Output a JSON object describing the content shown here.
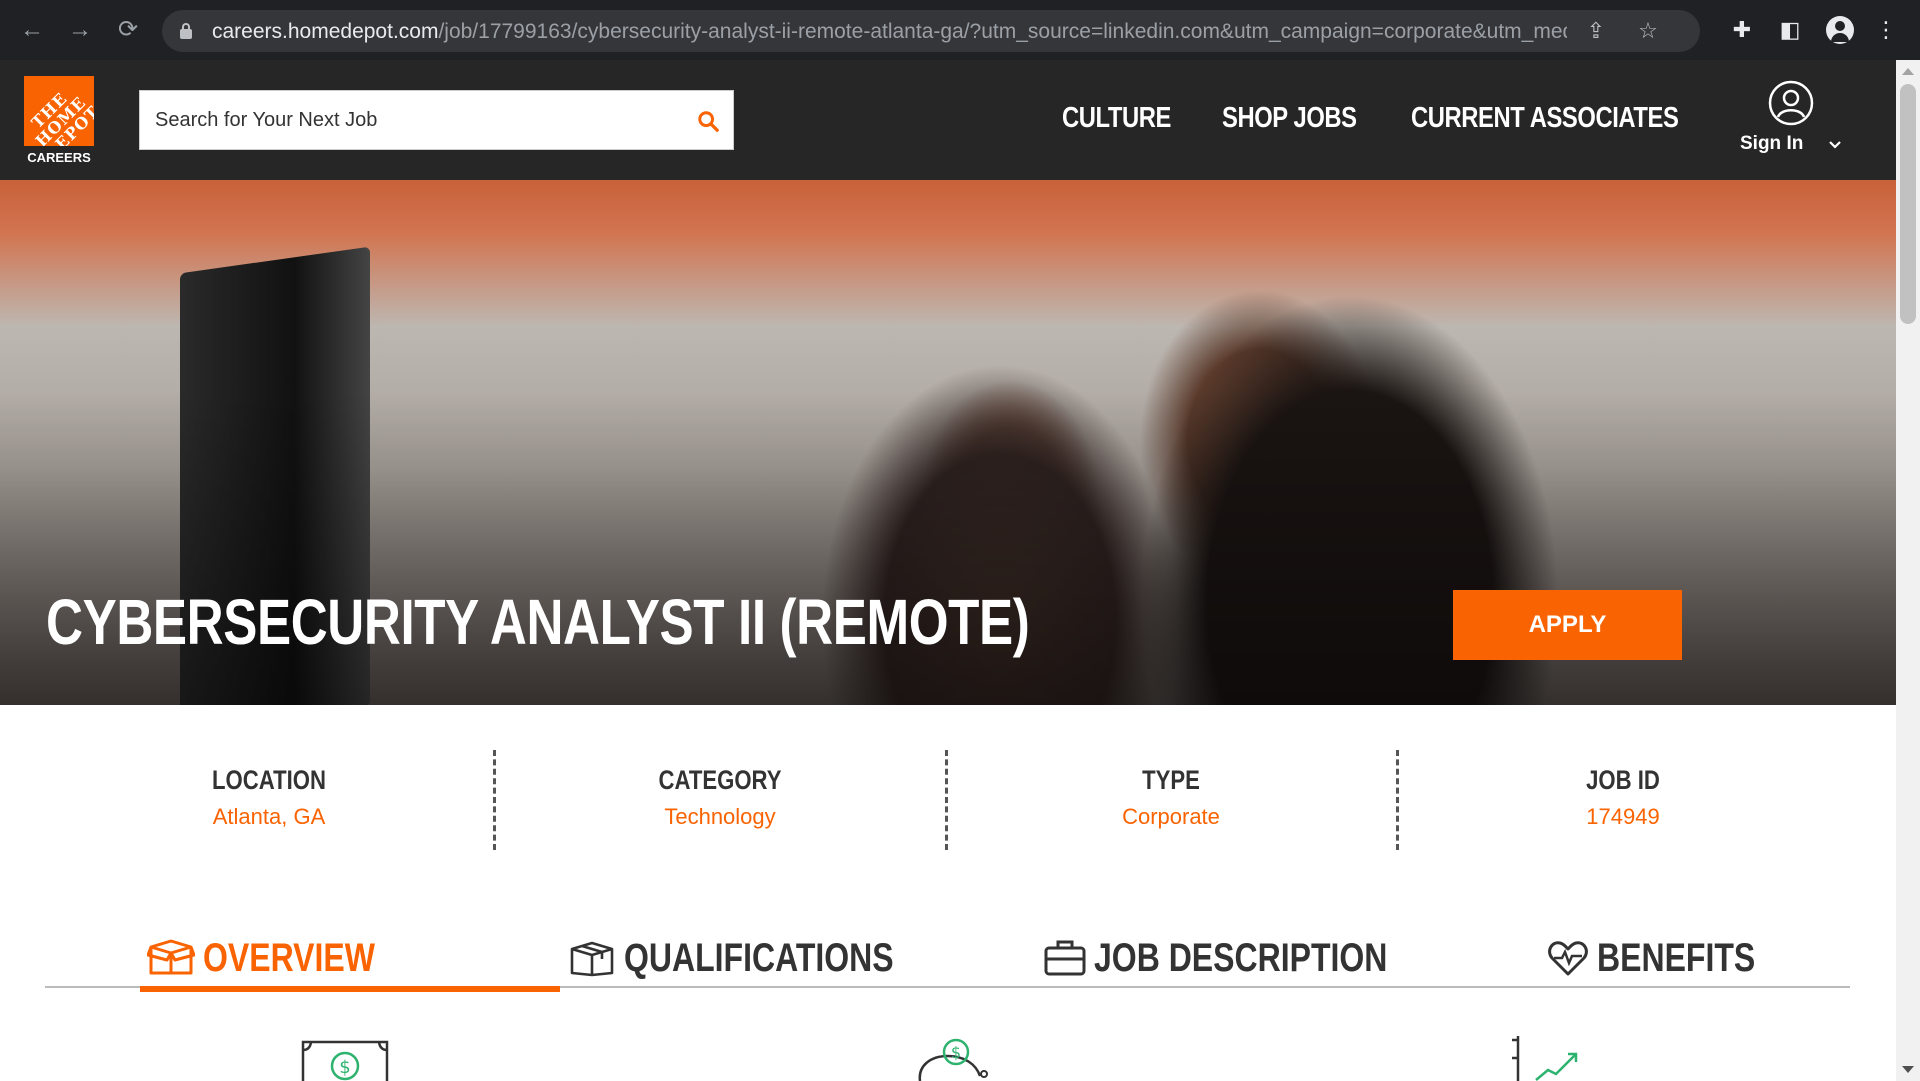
{
  "browser": {
    "url_host": "careers.homedepot.com",
    "url_path": "/job/17799163/cybersecurity-analyst-ii-remote-atlanta-ga/?utm_source=linkedin.com&utm_campaign=corporate&utm_med..."
  },
  "header": {
    "logo_text": "THE HOME DEPOT",
    "logo_caption": "CAREERS",
    "search_placeholder": "Search for Your Next Job",
    "nav": [
      "CULTURE",
      "SHOP JOBS",
      "CURRENT ASSOCIATES"
    ],
    "sign_in": "Sign In"
  },
  "hero": {
    "title": "CYBERSECURITY ANALYST II (REMOTE)",
    "apply_label": "APPLY"
  },
  "facts": [
    {
      "label": "LOCATION",
      "value": "Atlanta, GA"
    },
    {
      "label": "CATEGORY",
      "value": "Technology"
    },
    {
      "label": "TYPE",
      "value": "Corporate"
    },
    {
      "label": "JOB ID",
      "value": "174949"
    }
  ],
  "tabs": [
    {
      "label": "OVERVIEW",
      "icon": "box-open-icon",
      "active": true
    },
    {
      "label": "QUALIFICATIONS",
      "icon": "box-icon",
      "active": false
    },
    {
      "label": "JOB DESCRIPTION",
      "icon": "briefcase-icon",
      "active": false
    },
    {
      "label": "BENEFITS",
      "icon": "heart-pulse-icon",
      "active": false
    }
  ],
  "benefit_icons": [
    "money-bill-icon",
    "piggy-bank-icon",
    "growth-chart-icon"
  ],
  "colors": {
    "brand": "#f96302",
    "header_bg": "#262626",
    "text": "#333333"
  }
}
